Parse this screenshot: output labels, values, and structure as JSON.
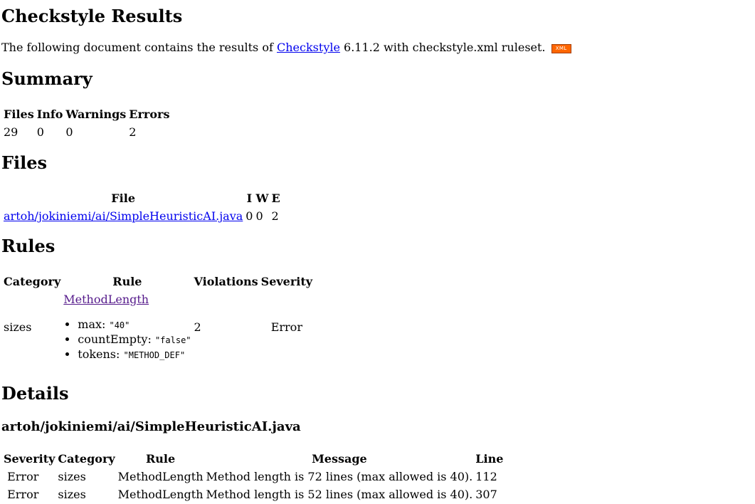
{
  "title": "Checkstyle Results",
  "intro": {
    "prefix": "The following document contains the results of ",
    "link": "Checkstyle",
    "suffix": " 6.11.2 with checkstyle.xml ruleset.",
    "badge": "XML"
  },
  "summary": {
    "heading": "Summary",
    "headers": [
      "Files",
      "Info",
      "Warnings",
      "Errors"
    ],
    "values": [
      "29",
      "0",
      "0",
      "2"
    ]
  },
  "files": {
    "heading": "Files",
    "headers": [
      "File",
      "I",
      "W",
      "E"
    ],
    "rows": [
      {
        "file": "artoh/jokiniemi/ai/SimpleHeuristicAI.java",
        "i": "0",
        "w": "0",
        "e": "2"
      }
    ]
  },
  "rules": {
    "heading": "Rules",
    "headers": [
      "Category",
      "Rule",
      "Violations",
      "Severity"
    ],
    "rows": [
      {
        "category": "sizes",
        "rule": "MethodLength",
        "props": [
          {
            "key": "max",
            "value": "\"40\""
          },
          {
            "key": "countEmpty",
            "value": "\"false\""
          },
          {
            "key": "tokens",
            "value": "\"METHOD_DEF\""
          }
        ],
        "violations": "2",
        "severity": "Error"
      }
    ]
  },
  "details": {
    "heading": "Details",
    "file": "artoh/jokiniemi/ai/SimpleHeuristicAI.java",
    "headers": [
      "Severity",
      "Category",
      "Rule",
      "Message",
      "Line"
    ],
    "rows": [
      {
        "severity": "Error",
        "category": "sizes",
        "rule": "MethodLength",
        "message": "Method length is 72 lines (max allowed is 40).",
        "line": "112"
      },
      {
        "severity": "Error",
        "category": "sizes",
        "rule": "MethodLength",
        "message": "Method length is 52 lines (max allowed is 40).",
        "line": "307"
      }
    ]
  },
  "colors": {
    "link": "#0000ee",
    "visited_link": "#551a8b",
    "badge": "#ff6600"
  },
  "icons": {
    "xml_badge": "xml-feed-icon"
  }
}
